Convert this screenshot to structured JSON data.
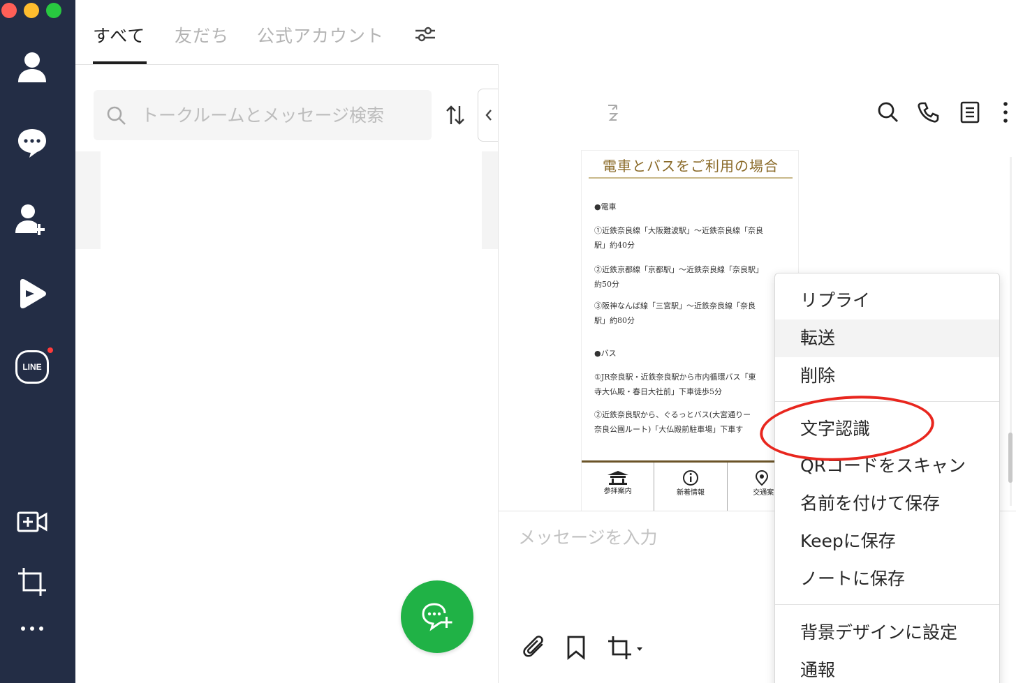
{
  "window": {
    "traffic_lights": [
      {
        "name": "close",
        "color": "#ff5f57"
      },
      {
        "name": "minimize",
        "color": "#febc2e"
      },
      {
        "name": "maximize",
        "color": "#28c840"
      }
    ]
  },
  "sidebar": {
    "items": [
      {
        "name": "friends",
        "icon": "person-icon"
      },
      {
        "name": "chats",
        "icon": "chat-bubble-icon"
      },
      {
        "name": "add-friend",
        "icon": "add-person-icon"
      },
      {
        "name": "voom",
        "icon": "play-icon"
      },
      {
        "name": "line",
        "icon": "line-logo-icon",
        "label": "LINE"
      }
    ],
    "bottom_items": [
      {
        "name": "video-call",
        "icon": "video-add-icon"
      },
      {
        "name": "screenshot",
        "icon": "crop-icon"
      },
      {
        "name": "more",
        "icon": "more-dots-icon"
      }
    ],
    "colors": {
      "background": "#232d45",
      "icon": "#ffffff",
      "notification": "#ff3b3b"
    }
  },
  "tabs": {
    "items": [
      {
        "label": "すべて",
        "active": true
      },
      {
        "label": "友だち",
        "active": false
      },
      {
        "label": "公式アカウント",
        "active": false
      }
    ],
    "filter_icon": "sliders-icon"
  },
  "search": {
    "placeholder": "トークルームとメッセージ検索",
    "value": ""
  },
  "chat_image": {
    "title": "電車とバスをご利用の場合",
    "lines": [
      "●電車",
      "①近鉄奈良線「大阪難波駅」〜近鉄奈良線「奈良",
      "駅」約40分",
      "②近鉄京都線「京都駅」〜近鉄奈良線「奈良駅」",
      "約50分",
      "③阪神なんば線「三宮駅」〜近鉄奈良線「奈良",
      "駅」約80分",
      "●バス",
      "①JR奈良駅・近鉄奈良駅から市内循環バス「東",
      "寺大仏殿・春日大社前」下車徒歩5分",
      "②近鉄奈良駅から、ぐるっとバス(大宮通りー",
      "奈良公園ルート)「大仏殿前駐車場」下車す"
    ],
    "bottom_cells": [
      {
        "label": "参拝案内",
        "icon": "temple-icon"
      },
      {
        "label": "新着情報",
        "icon": "info-icon"
      },
      {
        "label": "交通案",
        "icon": "map-pin-icon"
      }
    ]
  },
  "chat_header": {
    "icons": [
      "search-icon",
      "phone-icon",
      "notes-icon",
      "more-vertical-icon"
    ]
  },
  "message_input": {
    "placeholder": "メッセージを入力"
  },
  "toolbar": {
    "icons": [
      "attach-icon",
      "bookmark-icon",
      "crop-icon"
    ]
  },
  "context_menu": {
    "groups": [
      [
        "リプライ",
        "転送",
        "削除"
      ],
      [
        "文字認識",
        "QRコードをスキャン",
        "名前を付けて保存",
        "Keepに保存",
        "ノートに保存"
      ],
      [
        "背景デザインに設定",
        "通報"
      ]
    ],
    "hovered": "転送",
    "highlighted": "文字認識",
    "highlight_color": "#e8261e"
  },
  "fab": {
    "icon": "new-chat-icon",
    "color": "#20b246"
  }
}
